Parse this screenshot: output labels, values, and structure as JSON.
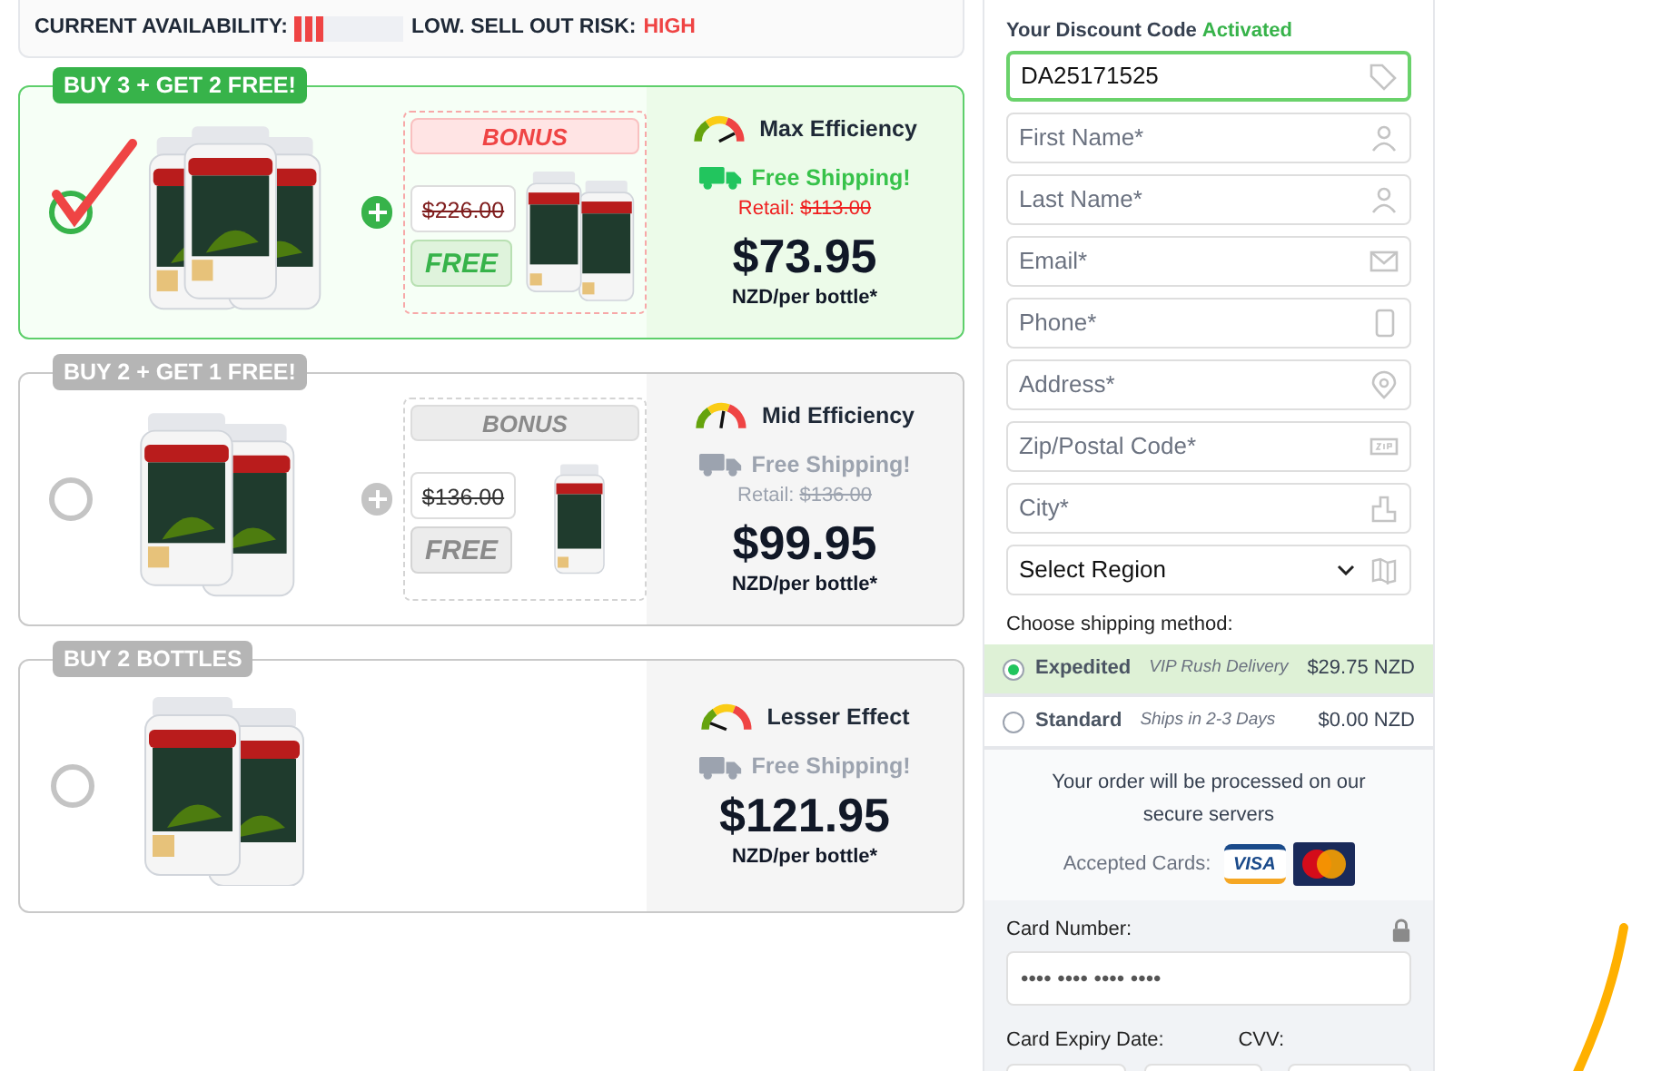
{
  "availability": {
    "label": "CURRENT AVAILABILITY:",
    "level": 0.3,
    "risk_label": "LOW. SELL OUT RISK:",
    "risk": "HIGH"
  },
  "offers": [
    {
      "tag": "BUY 3 + GET 2 FREE!",
      "selected": true,
      "bonus": {
        "label": "BONUS",
        "old_price": "$226.00",
        "free": "FREE"
      },
      "efficiency": "Max Efficiency",
      "kind": "high",
      "shipping": "Free Shipping!",
      "retail_label": "Retail:",
      "retail_price": "$113.00",
      "price": "$73.95",
      "unit": "NZD/per bottle*"
    },
    {
      "tag": "BUY 2 + GET 1 FREE!",
      "selected": false,
      "bonus": {
        "label": "BONUS",
        "old_price": "$136.00",
        "free": "FREE"
      },
      "efficiency": "Mid Efficiency",
      "kind": "mid",
      "shipping": "Free Shipping!",
      "retail_label": "Retail:",
      "retail_price": "$136.00",
      "price": "$99.95",
      "unit": "NZD/per bottle*"
    },
    {
      "tag": "BUY 2 BOTTLES",
      "selected": false,
      "efficiency": "Lesser Effect",
      "kind": "low",
      "shipping": "Free Shipping!",
      "price": "$121.95",
      "unit": "NZD/per bottle*"
    }
  ],
  "form": {
    "discount_label": "Your Discount Code",
    "discount_status": "Activated",
    "discount_code": "DA25171525",
    "fields": [
      {
        "placeholder": "First Name*",
        "kind": "person"
      },
      {
        "placeholder": "Last Name*",
        "kind": "person"
      },
      {
        "placeholder": "Email*",
        "kind": "mail"
      },
      {
        "placeholder": "Phone*",
        "kind": "phone"
      },
      {
        "placeholder": "Address*",
        "kind": "pin"
      },
      {
        "placeholder": "Zip/Postal Code*",
        "kind": "zip"
      },
      {
        "placeholder": "City*",
        "kind": "city"
      }
    ],
    "region": "Select Region",
    "shipping_label": "Choose shipping method:",
    "shipping_options": [
      {
        "name": "Expedited",
        "note": "VIP Rush Delivery",
        "price": "$29.75 NZD",
        "selected": true
      },
      {
        "name": "Standard",
        "note": "Ships in 2-3 Days",
        "price": "$0.00 NZD",
        "selected": false
      }
    ],
    "secure_text": "Your order will be processed on our secure servers",
    "cards_label": "Accepted Cards:",
    "visa": "VISA",
    "card_number_label": "Card Number:",
    "card_number_placeholder": "•••• •••• •••• ••••",
    "expiry_label": "Card Expiry Date:",
    "cvv_label": "CVV:"
  }
}
